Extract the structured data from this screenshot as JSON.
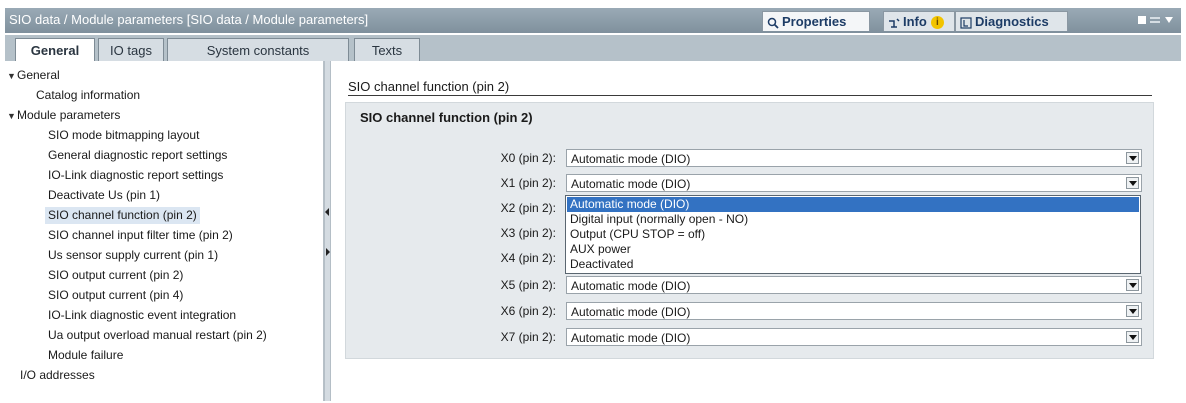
{
  "titlebar": {
    "title": "SIO data / Module parameters [SIO data / Module parameters]",
    "properties_tab": "Properties",
    "info_tab": "Info",
    "info_badge": "i",
    "diagnostics_tab": "Diagnostics"
  },
  "tabs": [
    "General",
    "IO tags",
    "System constants",
    "Texts"
  ],
  "tree": {
    "general": "General",
    "catalog_information": "Catalog information",
    "module_parameters": "Module parameters",
    "items": [
      "SIO mode bitmapping layout",
      "General diagnostic report settings",
      "IO-Link diagnostic report settings",
      "Deactivate Us (pin 1)",
      "SIO channel function (pin 2)",
      "SIO channel input filter time (pin 2)",
      "Us sensor supply current (pin 1)",
      "SIO output current (pin 2)",
      "SIO output current (pin 4)",
      "IO-Link diagnostic event integration",
      "Ua output overload manual restart (pin 2)",
      "Module failure"
    ],
    "io_addresses": "I/O addresses"
  },
  "main": {
    "section_heading": "SIO channel function (pin 2)",
    "group_title": "SIO channel function (pin 2)",
    "rows": [
      {
        "label": "X0 (pin 2):",
        "value": "Automatic mode (DIO)"
      },
      {
        "label": "X1 (pin 2):",
        "value": "Automatic mode (DIO)"
      },
      {
        "label": "X2 (pin 2):",
        "value": ""
      },
      {
        "label": "X3 (pin 2):",
        "value": ""
      },
      {
        "label": "X4 (pin 2):",
        "value": ""
      },
      {
        "label": "X5 (pin 2):",
        "value": "Automatic mode (DIO)"
      },
      {
        "label": "X6 (pin 2):",
        "value": "Automatic mode (DIO)"
      },
      {
        "label": "X7 (pin 2):",
        "value": "Automatic mode (DIO)"
      }
    ],
    "dropdown_options": [
      "Automatic mode (DIO)",
      "Digital input (normally open - NO)",
      "Output (CPU STOP = off)",
      "AUX power",
      "Deactivated"
    ]
  },
  "colors": {
    "titlebar": "#8a9ba8",
    "selection": "#3372c2",
    "group_background": "#e6eaed"
  }
}
